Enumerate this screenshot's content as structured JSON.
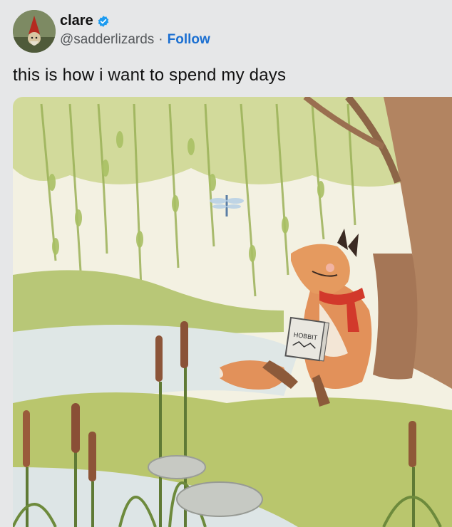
{
  "author": {
    "display_name": "clare",
    "handle": "@sadderlizards",
    "separator": "·",
    "follow_label": "Follow",
    "verified": true
  },
  "tweet": {
    "text": "this is how i want to spend my days"
  },
  "media": {
    "book_title": "HOBBIT"
  },
  "colors": {
    "follow_blue": "#1b6fd1",
    "verified_blue": "#1d9bf0",
    "background": "#e6e7e8"
  },
  "icons": [
    "verified-badge-icon"
  ]
}
